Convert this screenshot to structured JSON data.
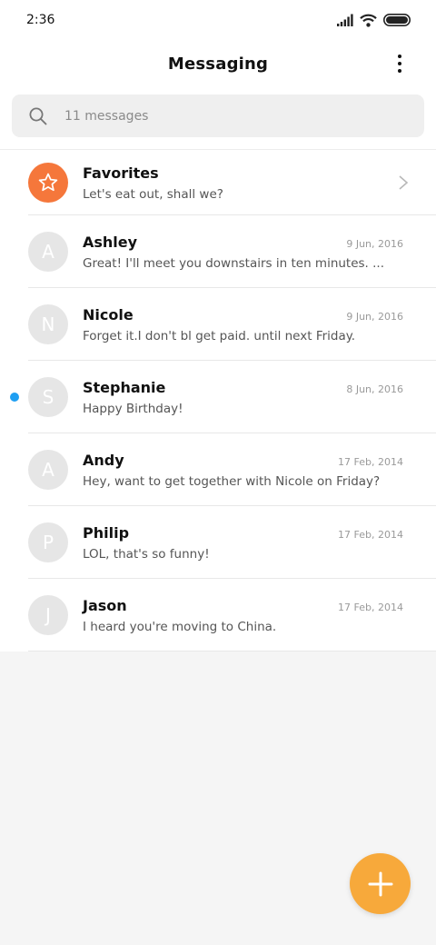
{
  "status_bar": {
    "time": "2:36"
  },
  "header": {
    "title": "Messaging"
  },
  "search": {
    "placeholder": "11 messages"
  },
  "favorites": {
    "name": "Favorites",
    "preview": "Let's eat out, shall we?"
  },
  "conversations": [
    {
      "initial": "A",
      "name": "Ashley",
      "date": "9 Jun, 2016",
      "preview": "Great! I'll meet you downstairs in ten minutes. ...",
      "unread": false
    },
    {
      "initial": "N",
      "name": "Nicole",
      "date": "9 Jun, 2016",
      "preview": "Forget it.I don't bl get paid. until next Friday.",
      "unread": false
    },
    {
      "initial": "S",
      "name": "Stephanie",
      "date": "8 Jun, 2016",
      "preview": "Happy Birthday!",
      "unread": true
    },
    {
      "initial": "A",
      "name": "Andy",
      "date": "17 Feb, 2014",
      "preview": "Hey, want to get together with Nicole on Friday?",
      "unread": false
    },
    {
      "initial": "P",
      "name": "Philip",
      "date": "17 Feb, 2014",
      "preview": "LOL, that's so funny!",
      "unread": false
    },
    {
      "initial": "J",
      "name": "Jason",
      "date": "17 Feb, 2014",
      "preview": "I heard you're moving to China.",
      "unread": false
    }
  ],
  "icons": {
    "search": "search-icon",
    "menu": "more-vertical-icon",
    "favorites": "star-icon",
    "chevron": "chevron-right-icon",
    "compose": "plus-icon"
  },
  "colors": {
    "favorites_avatar": "#f5773b",
    "unread_dot": "#1f9ff2",
    "fab": "#f7a93b",
    "avatar": "#e6e6e6"
  }
}
